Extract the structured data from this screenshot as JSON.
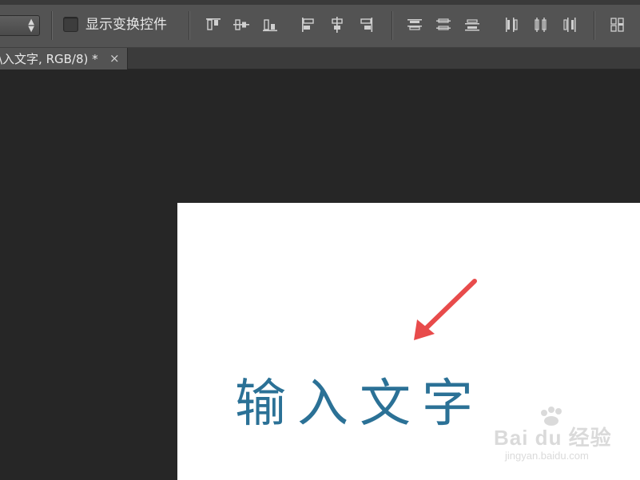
{
  "options_bar": {
    "show_transform_controls_label": "显示变换控件",
    "show_transform_controls_checked": false,
    "align_buttons": [
      "align-top-edges-icon",
      "align-vertical-centers-icon",
      "align-bottom-edges-icon",
      "align-left-edges-icon",
      "align-horizontal-centers-icon",
      "align-right-edges-icon"
    ],
    "distribute_buttons": [
      "distribute-top-edges-icon",
      "distribute-vertical-centers-icon",
      "distribute-bottom-edges-icon",
      "distribute-left-edges-icon",
      "distribute-horizontal-centers-icon",
      "distribute-right-edges-icon",
      "auto-align-layers-icon"
    ]
  },
  "document_tab": {
    "label": "\\入文字, RGB/8) *",
    "close_glyph": "×"
  },
  "canvas": {
    "text": "输入文字",
    "text_color": "#2b7196",
    "arrow_color": "#e84b4b"
  },
  "watermark": {
    "brand": "Bai du 经验",
    "url": "jingyan.baidu.com"
  },
  "colors": {
    "options_bar_bg": "#535353",
    "workspace_bg": "#262626",
    "canvas_bg": "#ffffff"
  }
}
